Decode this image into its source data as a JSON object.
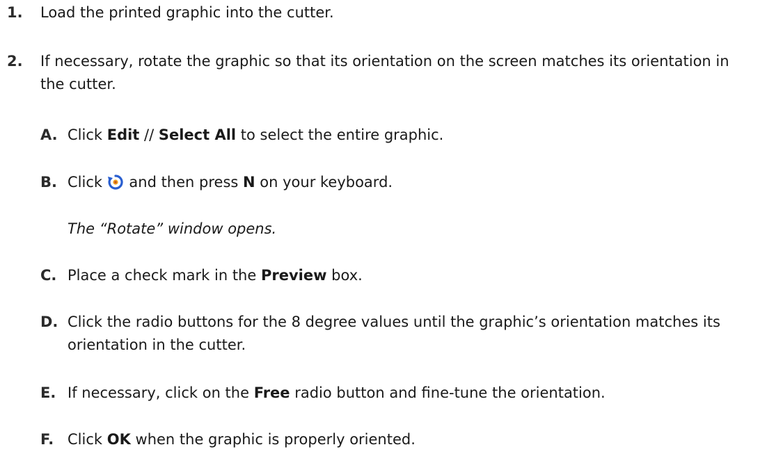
{
  "steps": [
    {
      "number": "1.",
      "text": "Load the printed graphic into the cutter."
    },
    {
      "number": "2.",
      "text": "If necessary, rotate the graphic so that its orientation on the screen matches its orientation in the cutter."
    }
  ],
  "substeps": {
    "a": {
      "letter": "A.",
      "click": "Click ",
      "edit": "Edit",
      "sep": " // ",
      "select_all": "Select All",
      "rest": " to select the entire graphic."
    },
    "b": {
      "letter": "B.",
      "click": "Click ",
      "icon": "rotate-tool-icon",
      "mid": " and then press ",
      "key": "N",
      "rest": " on your keyboard.",
      "note": "The “Rotate” window opens."
    },
    "c": {
      "letter": "C.",
      "pre": "Place a check mark in the ",
      "preview": "Preview",
      "rest": " box."
    },
    "d": {
      "letter": "D.",
      "text": "Click the radio buttons for the 8 degree values until the graphic’s orientation matches its orientation in the cutter."
    },
    "e": {
      "letter": "E.",
      "pre": "If necessary, click on the ",
      "free": "Free",
      "rest": " radio button and fine-tune the orientation."
    },
    "f": {
      "letter": "F.",
      "click": "Click ",
      "ok": "OK",
      "rest": " when the graphic is properly oriented."
    }
  },
  "colors": {
    "text": "#1a1a1a",
    "icon_primary": "#2a5fd0",
    "icon_accent": "#f0a020"
  }
}
